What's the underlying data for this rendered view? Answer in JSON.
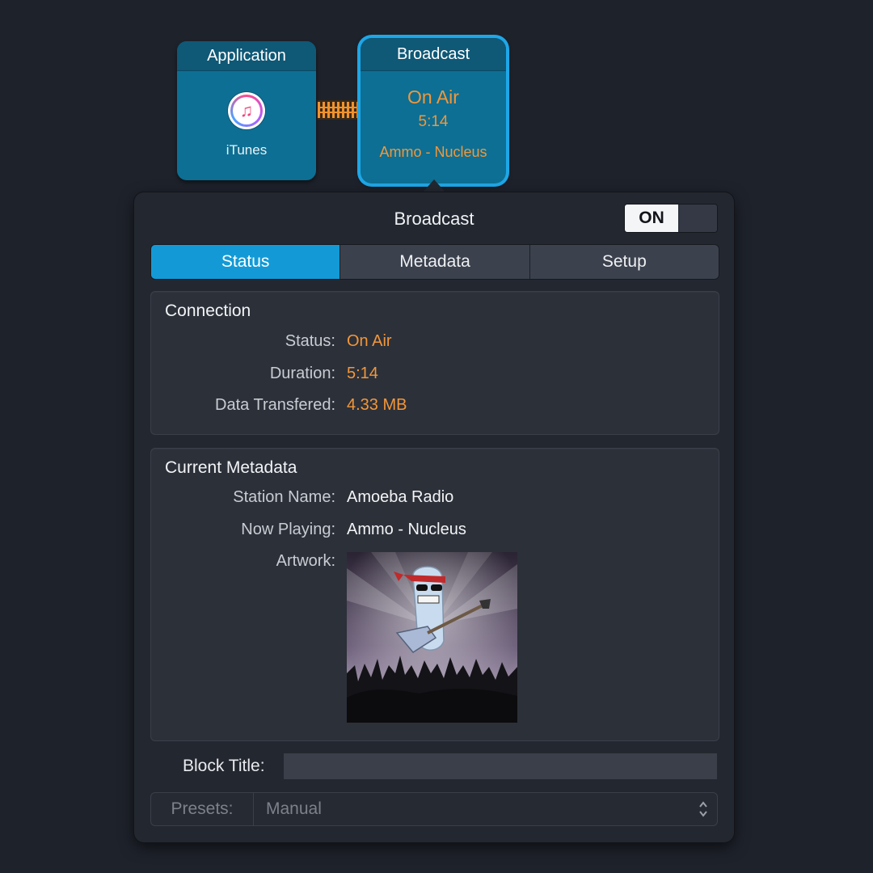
{
  "blocks": {
    "application": {
      "header": "Application",
      "app_icon": "itunes-icon",
      "app_name": "iTunes"
    },
    "broadcast": {
      "header": "Broadcast",
      "status": "On Air",
      "duration": "5:14",
      "now_playing": "Ammo - Nucleus"
    }
  },
  "panel": {
    "title": "Broadcast",
    "toggle": {
      "label": "ON",
      "state": "on"
    },
    "tabs": [
      {
        "label": "Status",
        "active": true
      },
      {
        "label": "Metadata",
        "active": false
      },
      {
        "label": "Setup",
        "active": false
      }
    ],
    "connection": {
      "title": "Connection",
      "status_label": "Status:",
      "status_value": "On Air",
      "duration_label": "Duration:",
      "duration_value": "5:14",
      "data_label": "Data Transfered:",
      "data_value": "4.33 MB"
    },
    "metadata": {
      "title": "Current Metadata",
      "station_label": "Station Name:",
      "station_value": "Amoeba Radio",
      "now_playing_label": "Now Playing:",
      "now_playing_value": "Ammo - Nucleus",
      "artwork_label": "Artwork:"
    },
    "block_title": {
      "label": "Block Title:",
      "value": ""
    },
    "presets": {
      "label": "Presets:",
      "value": "Manual"
    }
  },
  "colors": {
    "accent_blue": "#139ad6",
    "block_teal": "#0d6f93",
    "status_orange": "#f2973a",
    "background": "#1e222b"
  }
}
